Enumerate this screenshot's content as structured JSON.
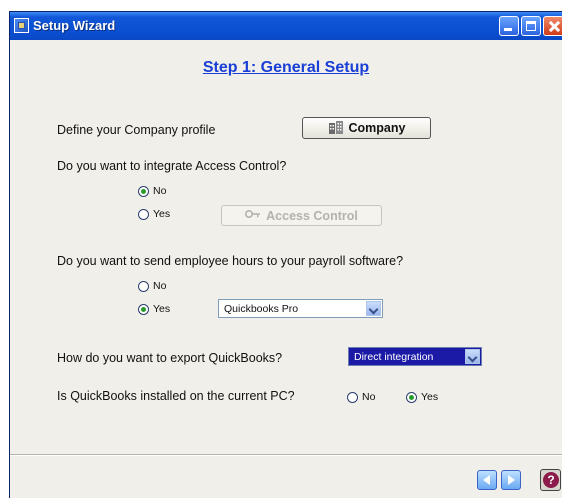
{
  "window": {
    "title": "Setup Wizard"
  },
  "step": {
    "title": "Step 1: General Setup"
  },
  "company": {
    "prompt": "Define your Company profile",
    "button_label": "Company",
    "button_icon": "building-icon"
  },
  "access_control": {
    "question": "Do you want to integrate Access Control?",
    "options": [
      {
        "label": "No",
        "selected": true
      },
      {
        "label": "Yes",
        "selected": false
      }
    ],
    "button_label": "Access Control",
    "button_enabled": false
  },
  "payroll": {
    "question": "Do you want to send employee hours to your payroll software?",
    "options": [
      {
        "label": "No",
        "selected": false
      },
      {
        "label": "Yes",
        "selected": true
      }
    ],
    "software_selected": "Quickbooks Pro"
  },
  "export": {
    "question": "How do you want to export QuickBooks?",
    "selected": "Direct integration"
  },
  "installed": {
    "question": "Is QuickBooks installed on the current PC?",
    "options": [
      {
        "label": "No",
        "selected": false
      },
      {
        "label": "Yes",
        "selected": true
      }
    ]
  },
  "footer": {
    "back_icon": "arrow-left-icon",
    "next_icon": "arrow-right-icon",
    "help_icon": "question-mark-icon",
    "help_glyph": "?"
  }
}
